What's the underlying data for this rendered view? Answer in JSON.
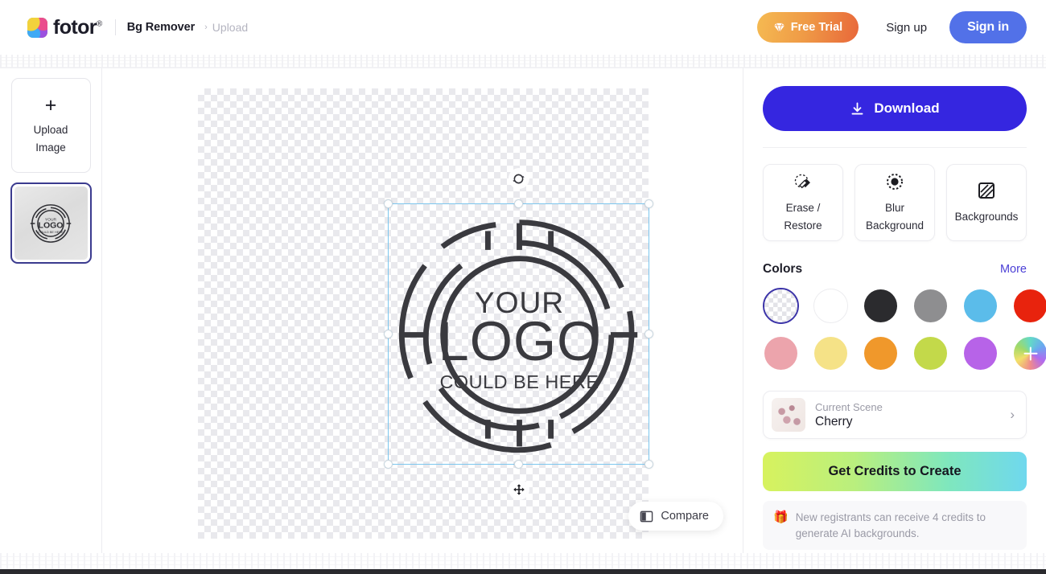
{
  "header": {
    "brand_name": "fotor",
    "brand_reg": "®",
    "tool_name": "Bg Remover",
    "crumb_sep": "›",
    "crumb_current": "Upload",
    "free_trial_label": "Free Trial",
    "sign_up_label": "Sign up",
    "sign_in_label": "Sign in",
    "diamond_icon": "diamond-icon"
  },
  "sidebar": {
    "upload_plus": "+",
    "upload_line1": "Upload",
    "upload_line2": "Image",
    "thumbnail_alt": "logo-thumbnail"
  },
  "canvas": {
    "rotate_icon": "rotate-icon",
    "move_icon": "move-icon",
    "compare_label": "Compare",
    "compare_icon": "compare-icon",
    "artwork": {
      "line1": "YOUR",
      "line2": "LOGO",
      "line3": "COULD BE HERE",
      "stroke_color": "#3a3a3f"
    },
    "selection_border_color": "#7cc6ee"
  },
  "panel": {
    "download_label": "Download",
    "download_icon": "download-icon",
    "download_color": "#3526e0",
    "tools": [
      {
        "label_line1": "Erase /",
        "label_line2": "Restore",
        "icon": "eraser-icon"
      },
      {
        "label_line1": "Blur",
        "label_line2": "Background",
        "icon": "blur-circle-icon"
      },
      {
        "label_line1": "Backgrounds",
        "label_line2": "",
        "icon": "hatched-square-icon"
      }
    ],
    "colors_title": "Colors",
    "colors_more": "More",
    "swatches_row1": [
      {
        "name": "transparent",
        "hex": "transparent",
        "selected": true
      },
      {
        "name": "white",
        "hex": "#ffffff",
        "selected": false
      },
      {
        "name": "black",
        "hex": "#2b2b2e",
        "selected": false
      },
      {
        "name": "gray",
        "hex": "#8e8e90",
        "selected": false
      },
      {
        "name": "light-blue",
        "hex": "#5bbcea",
        "selected": false
      },
      {
        "name": "red",
        "hex": "#e8230d",
        "selected": false
      }
    ],
    "swatches_row2": [
      {
        "name": "pink",
        "hex": "#eca4ac",
        "selected": false
      },
      {
        "name": "light-yellow",
        "hex": "#f5e287",
        "selected": false
      },
      {
        "name": "orange",
        "hex": "#f0982b",
        "selected": false
      },
      {
        "name": "yellow-green",
        "hex": "#c3d94a",
        "selected": false
      },
      {
        "name": "purple",
        "hex": "#b763e8",
        "selected": false
      },
      {
        "name": "rainbow-add",
        "hex": "rainbow",
        "selected": false
      }
    ],
    "scene_label": "Current Scene",
    "scene_value": "Cherry",
    "scene_chevron": "›",
    "credits_label": "Get Credits to Create",
    "notice_icon": "🎁",
    "notice_text": "New registrants can receive 4 credits to generate AI backgrounds."
  }
}
